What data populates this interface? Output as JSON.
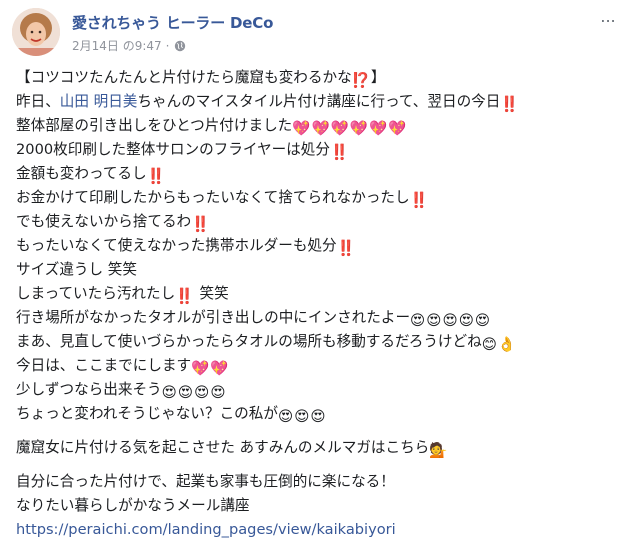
{
  "post": {
    "author": "愛されちゃう ヒーラー DeCo",
    "timestamp": "2月14日 の9:47",
    "privacy_separator": "·",
    "privacy_icon": "globe-icon",
    "menu_icon": "more-icon",
    "menu_label": "...",
    "lines": {
      "l1": "【コツコツたんたんと片付けたら魔窟も変わるかな",
      "l1_end": "】",
      "l2_pre": "昨日、",
      "l2_name": "山田 明日美",
      "l2_post": "ちゃんのマイスタイル片付け講座に行って、翌日の今日",
      "l3": "整体部屋の引き出しをひとつ片付けました",
      "l4": "2000枚印刷した整体サロンのフライヤーは処分",
      "l5": "金額も変わってるし",
      "l6": "お金かけて印刷したからもったいなくて捨てられなかったし",
      "l7": "でも使えないから捨てるわ",
      "l8": "もったいなくて使えなかった携帯ホルダーも処分",
      "l9": "サイズ違うし 笑笑",
      "l10_pre": "しまっていたら汚れたし",
      "l10_post": " 笑笑",
      "l11": "行き場所がなかったタオルが引き出しの中にインされたよー",
      "l12": "まあ、見直して使いづらかったらタオルの場所も移動するだろうけどね",
      "l13": "今日は、ここまでにします",
      "l14": "少しずつなら出来そう",
      "l15": "ちょっと変われそうじゃない？この私が",
      "l16": "魔窟女に片付ける気を起こさせた あすみんのメルマガはこちら",
      "l17": "自分に合った片付けで、起業も家事も圧倒的に楽になる！",
      "l18": "なりたい暮らしがかなうメール講座",
      "l19": "https://peraichi.com/landing_pages/view/kaikabiyori"
    },
    "emoji": {
      "exclaim_question": "⁉️",
      "double_exclaim": "‼️",
      "sparkling_heart": "💖",
      "heart_eyes": "😍",
      "smile": "😊",
      "ok_hand": "👌",
      "tipping_hand": "💁"
    },
    "colors": {
      "author": "#385898",
      "link": "#385898",
      "meta": "#90949c",
      "text": "#1c1e21",
      "emoji_red": "#e0245e"
    }
  }
}
